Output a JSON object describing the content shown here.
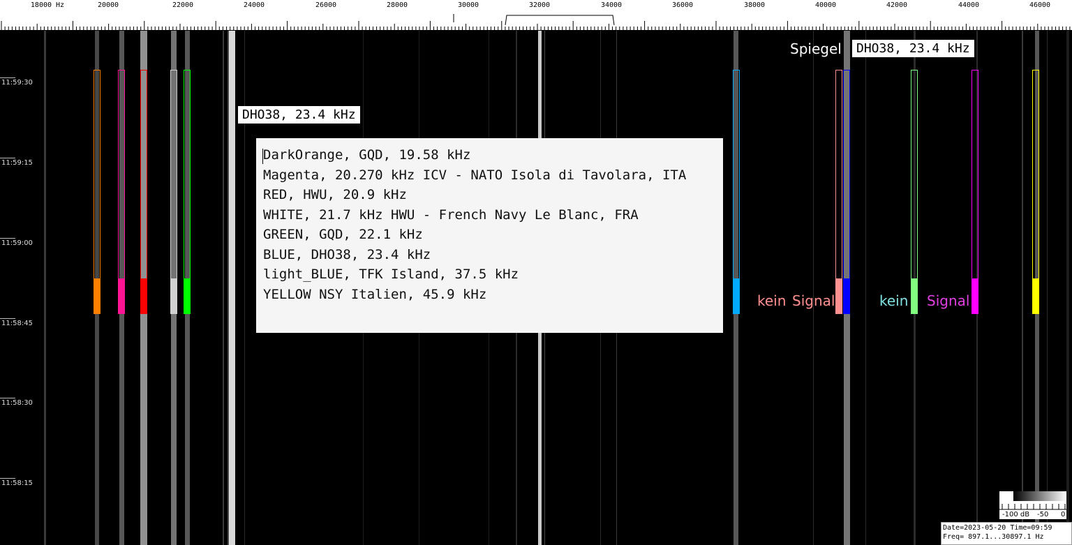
{
  "app": {
    "ruler": {
      "frequency_labels": [
        "18000 Hz",
        "20000",
        "22000",
        "24000",
        "26000",
        "28000",
        "30000",
        "32000",
        "34000",
        "36000",
        "38000",
        "40000",
        "42000",
        "44000",
        "46000"
      ]
    },
    "time_axis": {
      "labels": [
        "11:59:30",
        "11:59:15",
        "11:59:00",
        "11:58:45",
        "11:58:30",
        "11:58:15"
      ]
    },
    "markers": [
      {
        "color": "#ff8000",
        "name": "darkorange"
      },
      {
        "color": "#ff1493",
        "name": "magenta"
      },
      {
        "color": "#ff0000",
        "name": "red"
      },
      {
        "color": "#d0d0d0",
        "name": "white"
      },
      {
        "color": "#00ff00",
        "name": "green"
      },
      {
        "color": "#00aaff",
        "name": "light-blue"
      },
      {
        "color": "#ff9090",
        "name": "salmon"
      },
      {
        "color": "#0000ff",
        "name": "blue"
      },
      {
        "color": "#80ff80",
        "name": "light-green"
      },
      {
        "color": "#ff00ff",
        "name": "violet"
      },
      {
        "color": "#ffff00",
        "name": "yellow"
      }
    ],
    "labels": {
      "dho_box_left": "DHO38, 23.4 kHz",
      "spiegel": "Spiegel",
      "dho_box_right": "DHO38, 23.4 kHz",
      "kein_1": "kein",
      "signal_1": "Signal",
      "kein_2": "kein",
      "signal_2": "Signal"
    },
    "notes": [
      "DarkOrange, GQD, 19.58 kHz",
      "Magenta, 20.270 kHz ICV - NATO Isola di Tavolara, ITA",
      "RED, HWU, 20.9 kHz",
      "WHITE, 21.7 kHz HWU - French Navy Le Blanc, FRA",
      "GREEN, GQD, 22.1 kHz",
      "BLUE, DHO38, 23.4 kHz",
      "light_BLUE, TFK Island, 37.5 kHz",
      "YELLOW NSY Italien, 45.9 kHz"
    ],
    "db_scale": {
      "labels": [
        "-100 dB",
        "-50",
        "0"
      ]
    },
    "status": {
      "line1": "Date=2023-05-20 Time=09:59",
      "line2": "Freq= 897.1...30897.1 Hz"
    },
    "colors": {
      "kein_1": "#ff9090",
      "signal_1": "#ff9090",
      "kein_2": "#80e0e0",
      "signal_2": "#e040e0"
    }
  }
}
